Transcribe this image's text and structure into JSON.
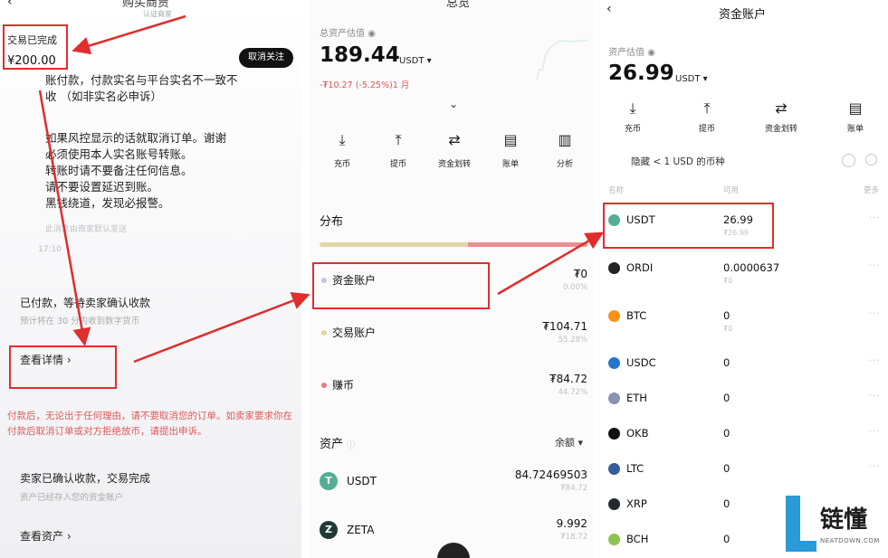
{
  "panel1": {
    "title": "购买商贾",
    "certified": "认证商家",
    "status": "交易已完成",
    "price": "¥200.00",
    "unfollow_label": "取消关注",
    "message_lines": [
      "账付款，付款实名与平台实名不一致不",
      "收  （如非实名必申诉）"
    ],
    "message_lines_2": [
      "如果风控显示的话就取消订单。谢谢",
      "必须使用本人实名账号转账。",
      "转账时请不要备注任何信息。",
      "请不要设置延迟到账。",
      "黑钱绕道，发现必报警。"
    ],
    "auto_sent": "此消息由商家默认发送",
    "time": "17:10",
    "paid_status": "已付款，等待卖家确认收款",
    "eta": "预计将在 30 分内收到数字货币",
    "view_details": "查看详情",
    "warning": "付款后，无论出于任何理由，请不要取消您的订单。如卖家要求你在付款后取消订单或对方拒绝放币，请提出申诉。",
    "done_status": "卖家已确认收款，交易完成",
    "stored_note": "资产已经存入您的资金账户",
    "view_assets": "查看资产"
  },
  "panel2": {
    "title": "总览",
    "est_label": "总资产估值",
    "total": "189.44",
    "currency": "USDT",
    "change": "-₮10.27 (-5.25%)1 月",
    "actions": [
      {
        "label": "充币",
        "icon": "deposit-icon",
        "glyph": "⤓"
      },
      {
        "label": "提币",
        "icon": "withdraw-icon",
        "glyph": "⤒"
      },
      {
        "label": "资金划转",
        "icon": "transfer-icon",
        "glyph": "⇄"
      },
      {
        "label": "账单",
        "icon": "bill-icon",
        "glyph": "▤"
      },
      {
        "label": "分析",
        "icon": "analysis-icon",
        "glyph": "▥"
      }
    ],
    "distribution_label": "分布",
    "distribution_fractions": [
      0.0,
      0.5529,
      0.4472
    ],
    "accounts": [
      {
        "name": "资金账户",
        "value": "₮0",
        "pct": "0.00%",
        "color": "#c9c3ea"
      },
      {
        "name": "交易账户",
        "value": "₮104.71",
        "pct": "55.28%",
        "color": "#e6d39d"
      },
      {
        "name": "赚币",
        "value": "₮84.72",
        "pct": "44.72%",
        "color": "#ea7878"
      }
    ],
    "assets_label": "资产",
    "balance_selector": "余额",
    "coins": [
      {
        "symbol": "USDT",
        "amount": "84.72469503",
        "fiat": "₮84.72",
        "color": "#53ae94",
        "glyph": "T"
      },
      {
        "symbol": "ZETA",
        "amount": "9.992",
        "fiat": "₮18.72",
        "color": "#1f3a35",
        "glyph": "Z"
      }
    ]
  },
  "panel3": {
    "title": "资金账户",
    "est_label": "资产估值",
    "total": "26.99",
    "currency": "USDT",
    "actions": [
      {
        "label": "充币",
        "icon": "deposit-icon",
        "glyph": "⤓"
      },
      {
        "label": "提币",
        "icon": "withdraw-icon",
        "glyph": "⤒"
      },
      {
        "label": "资金划转",
        "icon": "transfer-icon",
        "glyph": "⇄"
      },
      {
        "label": "账单",
        "icon": "bill-icon",
        "glyph": "▤"
      }
    ],
    "hide_small": "隐藏 < 1 USD 的币种",
    "col_name": "名称",
    "col_available": "可用",
    "col_more": "更多",
    "coins": [
      {
        "symbol": "USDT",
        "amount": "26.99",
        "fiat": "₮26.99",
        "color": "#53ae94",
        "glyph": "T"
      },
      {
        "symbol": "ORDI",
        "amount": "0.0000637",
        "fiat": "₮0",
        "color": "#222222",
        "glyph": "◎"
      },
      {
        "symbol": "BTC",
        "amount": "0",
        "fiat": "₮0",
        "color": "#f7931a",
        "glyph": "B"
      },
      {
        "symbol": "USDC",
        "amount": "0",
        "fiat": "",
        "color": "#2775ca",
        "glyph": "$"
      },
      {
        "symbol": "ETH",
        "amount": "0",
        "fiat": "",
        "color": "#8a92b2",
        "glyph": "◆"
      },
      {
        "symbol": "OKB",
        "amount": "0",
        "fiat": "",
        "color": "#111111",
        "glyph": "✦"
      },
      {
        "symbol": "LTC",
        "amount": "0",
        "fiat": "",
        "color": "#345d9d",
        "glyph": "Ł"
      },
      {
        "symbol": "XRP",
        "amount": "0",
        "fiat": "",
        "color": "#23292f",
        "glyph": "✕"
      },
      {
        "symbol": "BCH",
        "amount": "0",
        "fiat": "",
        "color": "#8dc351",
        "glyph": "B"
      }
    ]
  },
  "watermark": {
    "name": "链懂",
    "site": "NEATDOWN.COM"
  },
  "colors": {
    "highlight": "#e02d2d",
    "warning_text": "#e05858"
  }
}
